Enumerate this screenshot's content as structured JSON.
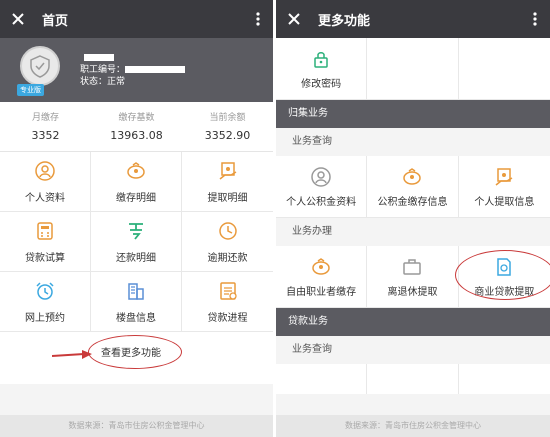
{
  "left": {
    "title": "首页",
    "profile": {
      "badge": "专业版",
      "id_label": "职工编号：",
      "status_label": "状态：",
      "status_value": "正常"
    },
    "stats": [
      {
        "label": "月缴存",
        "value": "3352"
      },
      {
        "label": "缴存基数",
        "value": "13963.08"
      },
      {
        "label": "当前余额",
        "value": "3352.90"
      }
    ],
    "grid": [
      {
        "label": "个人资料",
        "icon": "person-icon"
      },
      {
        "label": "缴存明细",
        "icon": "piggy-bank-icon"
      },
      {
        "label": "提取明细",
        "icon": "hand-coin-icon"
      },
      {
        "label": "贷款试算",
        "icon": "calculator-icon"
      },
      {
        "label": "还款明细",
        "icon": "repay-icon"
      },
      {
        "label": "逾期还款",
        "icon": "clock-icon"
      },
      {
        "label": "网上预约",
        "icon": "alarm-icon"
      },
      {
        "label": "楼盘信息",
        "icon": "building-icon"
      },
      {
        "label": "贷款进程",
        "icon": "progress-icon"
      }
    ],
    "more_link": "查看更多功能",
    "footer": "数据来源：青岛市住房公积金管理中心"
  },
  "right": {
    "title": "更多功能",
    "password_label": "修改密码",
    "sections": [
      {
        "title": "归集业务",
        "groups": [
          {
            "title": "业务查询",
            "items": [
              {
                "label": "个人公积金资料",
                "icon": "person-icon"
              },
              {
                "label": "公积金缴存信息",
                "icon": "piggy-bank-icon"
              },
              {
                "label": "个人提取信息",
                "icon": "hand-coin-icon"
              }
            ]
          },
          {
            "title": "业务办理",
            "items": [
              {
                "label": "自由职业者缴存",
                "icon": "piggy-bank-icon"
              },
              {
                "label": "离退休提取",
                "icon": "briefcase-icon"
              },
              {
                "label": "商业贷款提取",
                "icon": "document-icon"
              }
            ]
          }
        ]
      },
      {
        "title": "贷款业务",
        "groups": [
          {
            "title": "业务查询",
            "items": []
          }
        ]
      }
    ],
    "footer": "数据来源：青岛市住房公积金管理中心"
  },
  "colors": {
    "topbar": "#3a3a3f",
    "accent_orange": "#e99a3c",
    "accent_green": "#2bb07a",
    "accent_blue": "#3ba8e0",
    "annotation_red": "#c93a3a"
  }
}
